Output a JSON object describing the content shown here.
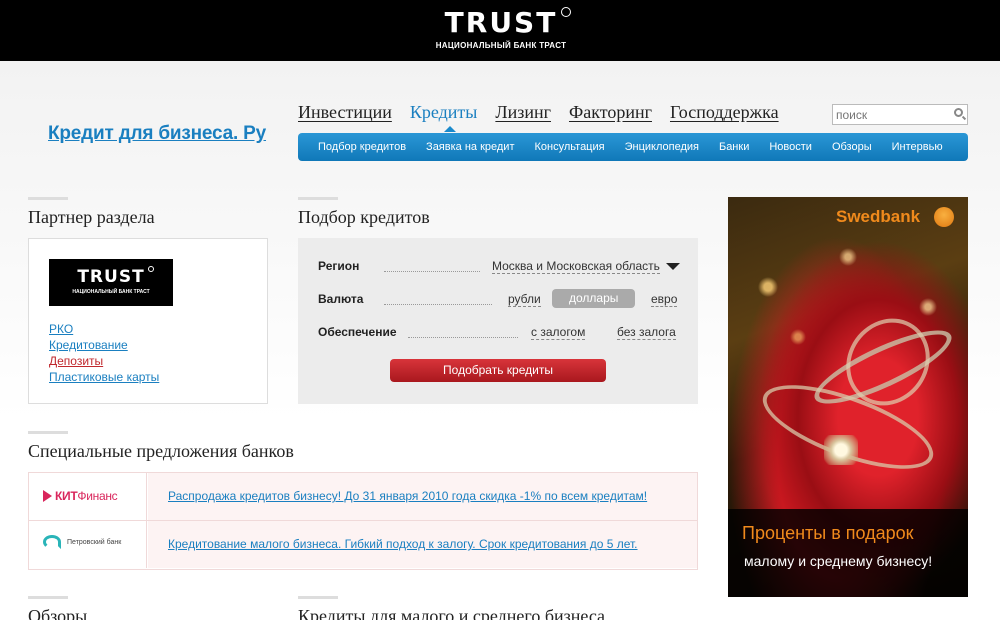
{
  "header": {
    "logo_word": "TRUST",
    "logo_sub": "НАЦИОНАЛЬНЫЙ БАНК ТРАСТ"
  },
  "site_title": "Кредит для бизнеса. Ру",
  "main_nav": [
    {
      "label": "Инвестиции",
      "active": false
    },
    {
      "label": "Кредиты",
      "active": true
    },
    {
      "label": "Лизинг",
      "active": false
    },
    {
      "label": "Факторинг",
      "active": false
    },
    {
      "label": "Господдержка",
      "active": false
    }
  ],
  "search": {
    "placeholder": "поиск",
    "icon": "search-icon"
  },
  "sub_nav": [
    "Подбор кредитов",
    "Заявка на кредит",
    "Консультация",
    "Энциклопедия",
    "Банки",
    "Новости",
    "Обзоры",
    "Интервью"
  ],
  "partner": {
    "heading": "Партнер раздела",
    "logo_word": "TRUST",
    "logo_sub": "НАЦИОНАЛЬНЫЙ БАНК ТРАСТ",
    "links": [
      {
        "label": "РКО",
        "color": "#1a7fc0"
      },
      {
        "label": "Кредитование",
        "color": "#1a7fc0"
      },
      {
        "label": "Депозиты",
        "color": "#c0272d"
      },
      {
        "label": "Пластиковые карты",
        "color": "#1a7fc0"
      }
    ]
  },
  "picker": {
    "heading": "Подбор кредитов",
    "region_label": "Регион",
    "region_value": "Москва и Московская область",
    "currency_label": "Валюта",
    "currency_options": [
      "рубли",
      "доллары",
      "евро"
    ],
    "currency_selected": "доллары",
    "collateral_label": "Обеспечение",
    "collateral_options": [
      "с залогом",
      "без залога"
    ],
    "submit_label": "Подобрать кредиты"
  },
  "offers": {
    "heading": "Специальные предложения банков",
    "items": [
      {
        "bank": "КИТФинанс",
        "bank_prefix": "КИТ",
        "bank_suffix": "Финанс",
        "text": "Распродажа кредитов бизнесу! До 31 января 2010 года скидка -1% по всем кредитам!"
      },
      {
        "bank": "Петровский банк",
        "text": "Кредитование малого бизнеса. Гибкий подход к залогу. Срок кредитования до 5 лет."
      }
    ]
  },
  "bottom_headings": {
    "left": "Обзоры",
    "right": "Кредиты для малого и среднего бизнеса"
  },
  "ad": {
    "brand": "Swedbank",
    "line1": "Проценты в подарок",
    "line2": "малому и среднему бизнесу!",
    "brand_color": "#f08a1c"
  }
}
